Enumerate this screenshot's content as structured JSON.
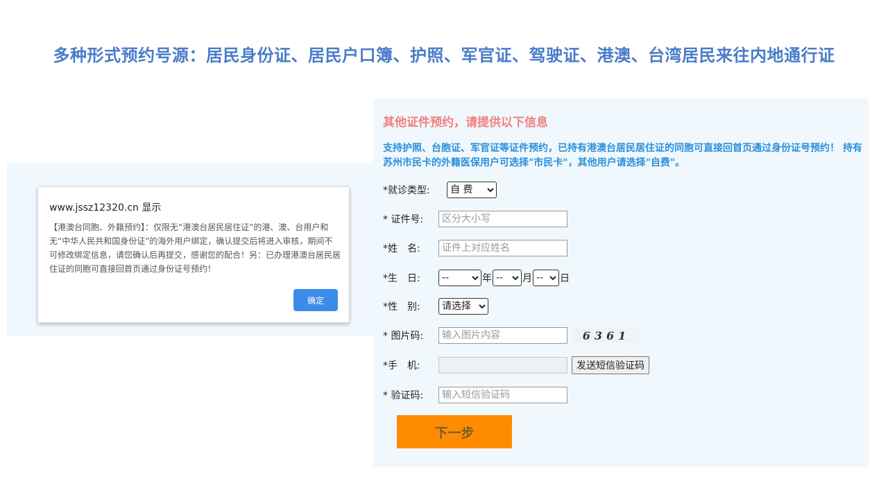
{
  "headline": "多种形式预约号源：居民身份证、居民户口簿、护照、军官证、驾驶证、港澳、台湾居民来往内地通行证",
  "dialog": {
    "title": "www.jssz12320.cn 显示",
    "body": "【港澳台同胞、外籍预约】：仅限无“港澳台居民居住证”的港、澳、台用户和无“中华人民共和国身份证”的海外用户绑定，确认提交后将进入审核，期间不可修改绑定信息，请您确认后再提交，感谢您的配合！另：已办理港澳台居民居住证的同胞可直接回首页通过身份证号预约！",
    "ok_label": "确定"
  },
  "form": {
    "title": "其他证件预约，请提供以下信息",
    "notice": "支持护照、台胞证、军官证等证件预约，已持有港澳台居民居住证的同胞可直接回首页通过身份证号预约！ 持有苏州市民卡的外籍医保用户可选择\"市民卡\"，其他用户请选择\"自费\"。",
    "visit_type": {
      "label": "*就诊类型:",
      "selected": "自 费"
    },
    "id_number": {
      "label": "* 证件号:",
      "placeholder": "区分大小写"
    },
    "name": {
      "label": "*姓　名:",
      "placeholder": "证件上对应姓名"
    },
    "birth": {
      "label": "*生　日:",
      "year_selected": "--",
      "year_unit": "年",
      "month_selected": "--",
      "month_unit": "月",
      "day_selected": "--",
      "day_unit": "日"
    },
    "gender": {
      "label": "*性　别:",
      "selected": "请选择"
    },
    "image_code": {
      "label": "* 图片码:",
      "placeholder": "输入图片内容",
      "captcha_text": "6361"
    },
    "phone": {
      "label": "*手　机:",
      "placeholder": "",
      "sms_button": "发送短信验证码"
    },
    "sms_code": {
      "label": "* 验证码:",
      "placeholder": "输入短信验证码"
    },
    "next_button": "下一步"
  }
}
